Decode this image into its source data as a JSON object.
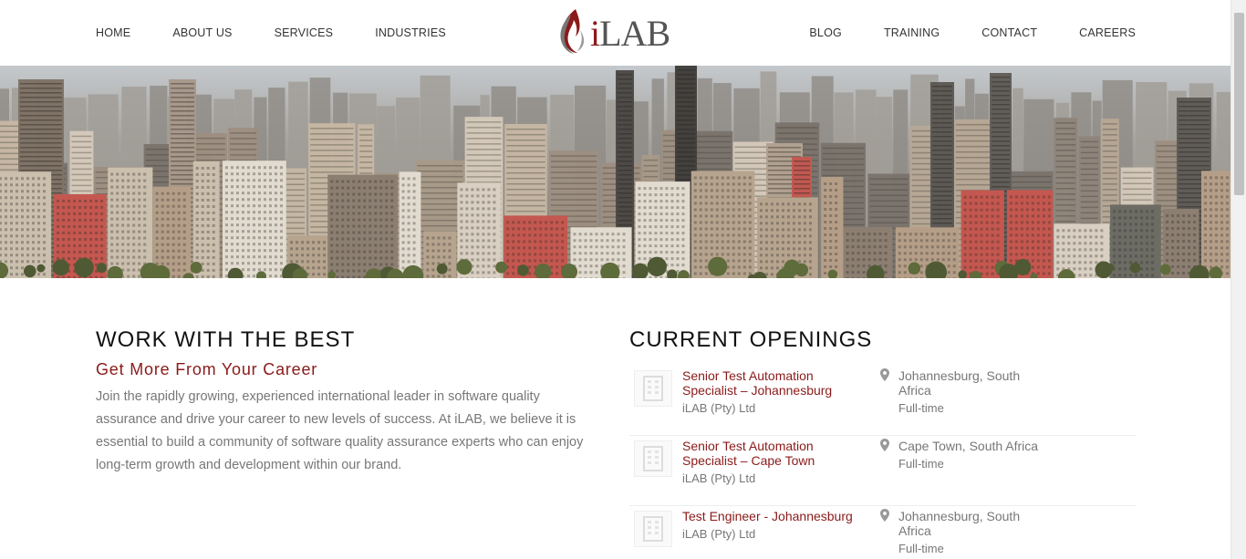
{
  "nav": {
    "left": [
      "HOME",
      "ABOUT US",
      "SERVICES",
      "INDUSTRIES"
    ],
    "right": [
      "BLOG",
      "TRAINING",
      "CONTACT",
      "CAREERS"
    ]
  },
  "logo": {
    "text_i": "i",
    "text_rest": "LAB"
  },
  "intro": {
    "heading": "WORK WITH THE BEST",
    "subheading": "Get More From Your Career",
    "body": "Join the rapidly growing, experienced international leader in software quality assurance and drive your career to new levels of success.  At iLAB, we believe it is essential to build a community of software quality assurance experts who can enjoy long-term growth and development within our brand."
  },
  "openings": {
    "heading": "CURRENT OPENINGS",
    "jobs": [
      {
        "title": "Senior Test Automation Specialist – Johannesburg",
        "company": "iLAB (Pty) Ltd",
        "location": "Johannesburg, South Africa",
        "type": "Full-time"
      },
      {
        "title": "Senior Test Automation Specialist – Cape Town",
        "company": "iLAB (Pty) Ltd",
        "location": "Cape Town, South Africa",
        "type": "Full-time"
      },
      {
        "title": "Test Engineer - Johannesburg",
        "company": "iLAB (Pty) Ltd",
        "location": "Johannesburg, South Africa",
        "type": "Full-time"
      }
    ]
  },
  "colors": {
    "accent": "#8b1a1a",
    "text_muted": "#777777"
  }
}
